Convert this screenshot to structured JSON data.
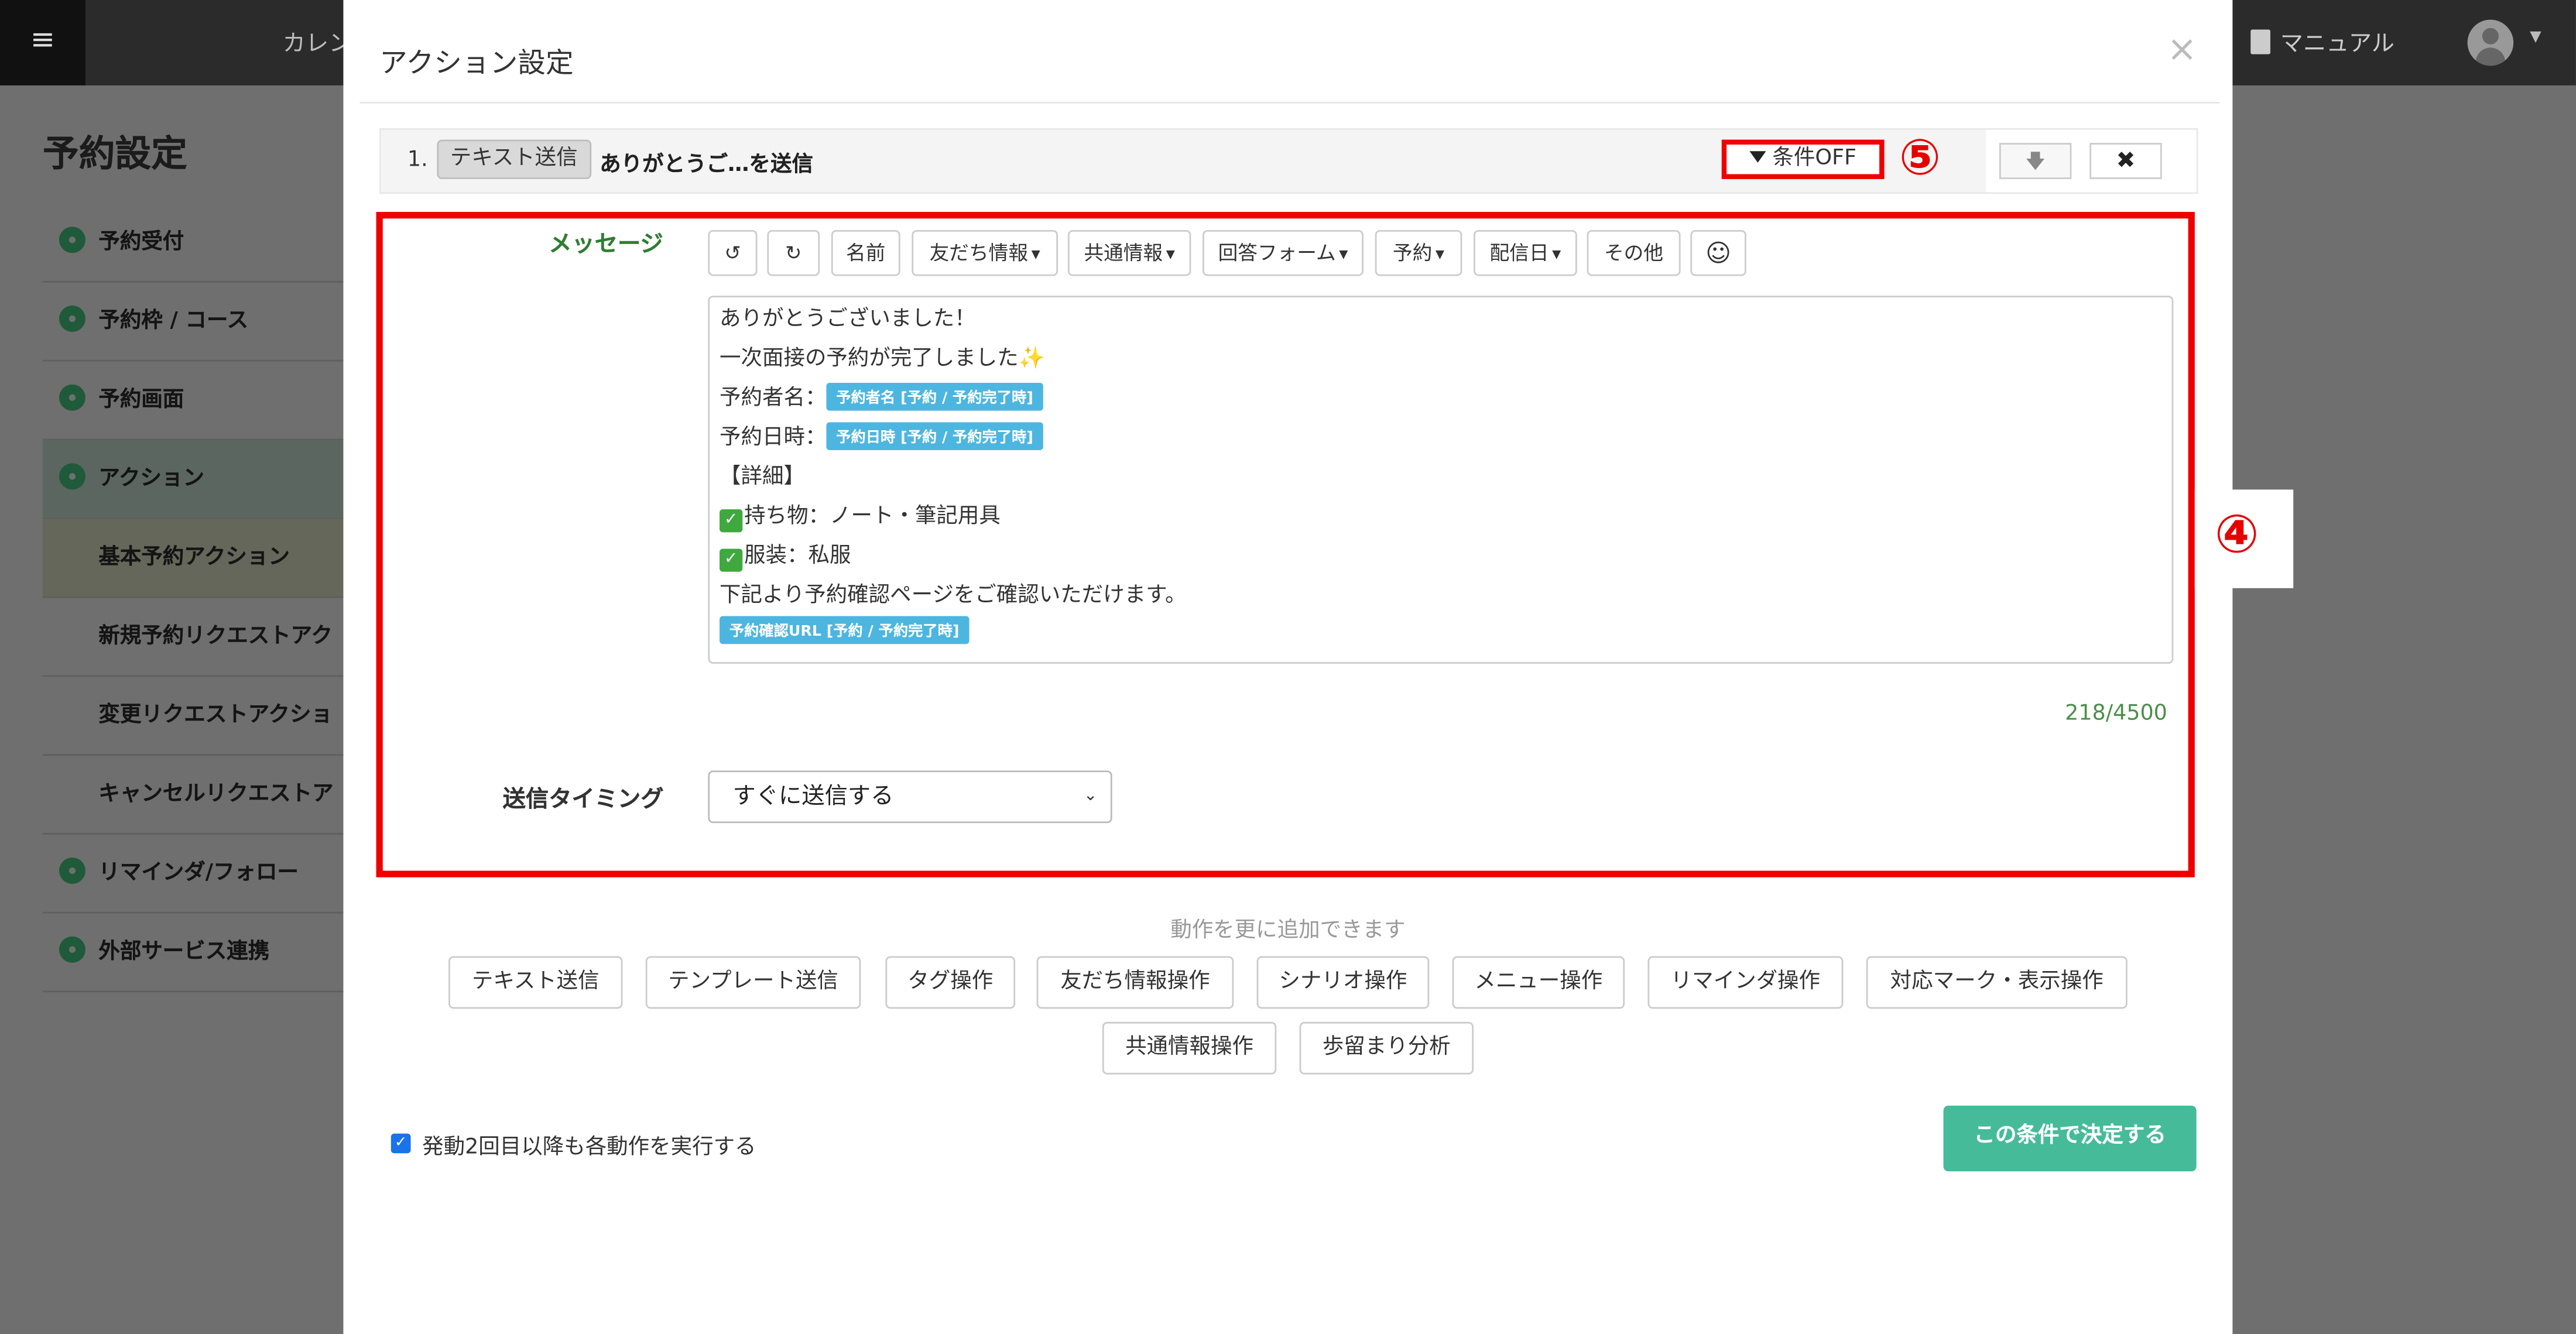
{
  "topbar": {
    "menu_icon": "≡",
    "tab_calendar": "カレン",
    "manual": "マニュアル"
  },
  "page": {
    "title": "予約設定"
  },
  "sidebar": {
    "items": [
      {
        "label": "予約受付"
      },
      {
        "label": "予約枠 / コース"
      },
      {
        "label": "予約画面"
      },
      {
        "label": "アクション"
      },
      {
        "label": "基本予約アクション"
      },
      {
        "label": "新規予約リクエストアク"
      },
      {
        "label": "変更リクエストアクショ"
      },
      {
        "label": "キャンセルリクエストア"
      },
      {
        "label": "リマインダ/フォロー"
      },
      {
        "label": "外部サービス連携"
      }
    ]
  },
  "modal": {
    "title": "アクション設定",
    "close": "×",
    "action_row": {
      "num": "1.",
      "type": "テキスト送信",
      "title": "ありがとうご…を送信",
      "condition": "条件OFF",
      "down": "🡇",
      "delete": "✖"
    },
    "annotations": {
      "five": "⑤",
      "four": "④"
    },
    "message_label": "メッセージ",
    "toolbar": {
      "undo": "↺",
      "redo": "↻",
      "name": "名前",
      "friend_info": "友だち情報",
      "common_info": "共通情報",
      "answer_form": "回答フォーム",
      "reserve": "予約",
      "delivery_date": "配信日",
      "other": "その他",
      "emoji": "☺"
    },
    "editor": {
      "line1": "ありがとうございました！",
      "line2": "一次面接の予約が完了しました",
      "line2_emoji": "✨",
      "line3": "予約者名：",
      "chip1": "予約者名 [予約 / 予約完了時]",
      "line4": "予約日時：",
      "chip2": "予約日時 [予約 / 予約完了時]",
      "line5": "【詳細】",
      "check_mark": "✓",
      "line6": "持ち物：ノート・筆記用具",
      "line7": "服装：私服",
      "line8": "下記より予約確認ページをご確認いただけます。",
      "chip3": "予約確認URL [予約 / 予約完了時]"
    },
    "counter": "218/4500",
    "timing_label": "送信タイミング",
    "timing_value": "すぐに送信する",
    "add_hint": "動作を更に追加できます",
    "add_buttons": {
      "text_send": "テキスト送信",
      "template_send": "テンプレート送信",
      "tag": "タグ操作",
      "friend_info": "友だち情報操作",
      "scenario": "シナリオ操作",
      "menu": "メニュー操作",
      "reminder": "リマインダ操作",
      "mark": "対応マーク・表示操作",
      "common_info": "共通情報操作",
      "yield": "歩留まり分析"
    },
    "repeat_label": "発動2回目以降も各動作を実行する",
    "confirm": "この条件で決定する"
  }
}
